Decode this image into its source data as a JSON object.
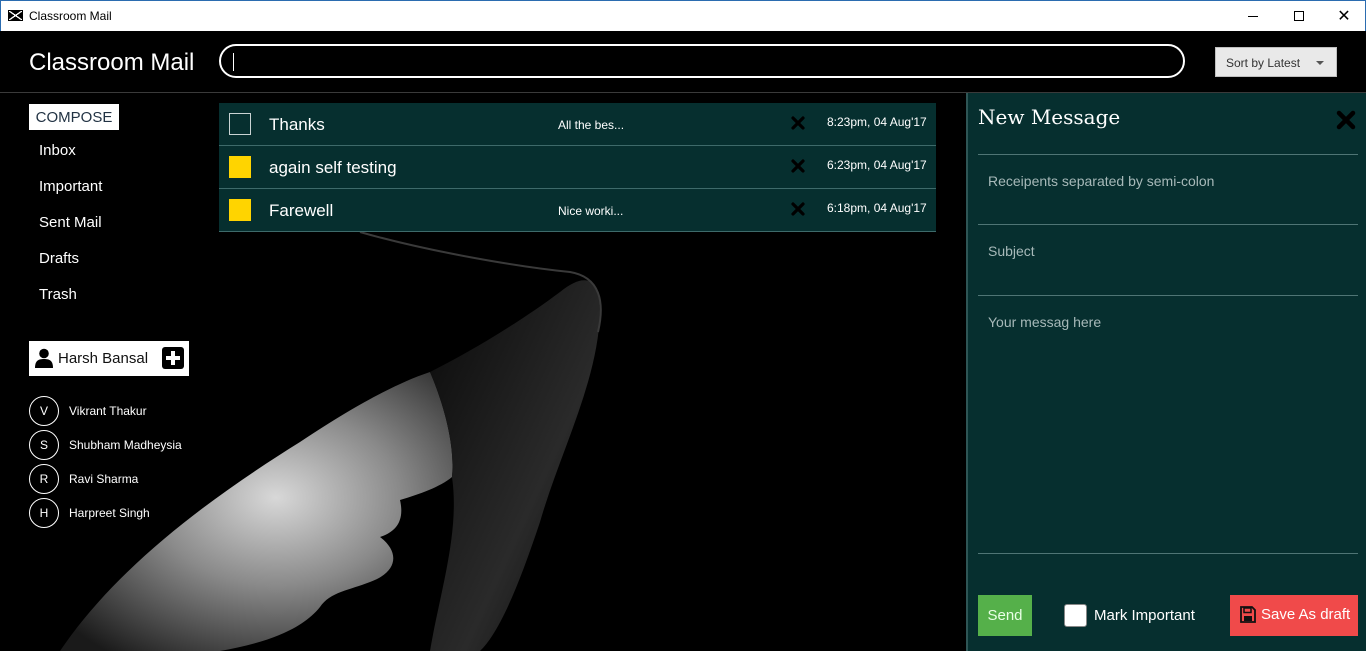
{
  "window": {
    "title": "Classroom Mail"
  },
  "header": {
    "app_title": "Classroom Mail",
    "search_value": "",
    "sort_label": "Sort by Latest"
  },
  "sidebar": {
    "compose_label": "COMPOSE",
    "items": [
      {
        "label": "Inbox"
      },
      {
        "label": "Important"
      },
      {
        "label": "Sent Mail"
      },
      {
        "label": "Drafts"
      },
      {
        "label": "Trash"
      }
    ],
    "user_name": "Harsh Bansal",
    "contacts": [
      {
        "initial": "V",
        "name": "Vikrant Thakur"
      },
      {
        "initial": "S",
        "name": "Shubham Madheysia"
      },
      {
        "initial": "R",
        "name": "Ravi Sharma"
      },
      {
        "initial": "H",
        "name": "Harpreet Singh"
      }
    ]
  },
  "mails": [
    {
      "subject": "Thanks",
      "snippet": "All the bes...",
      "date": "8:23pm, 04 Aug'17",
      "important": false
    },
    {
      "subject": "again self testing",
      "snippet": "",
      "date": "6:23pm, 04 Aug'17",
      "important": true
    },
    {
      "subject": "Farewell",
      "snippet": "Nice worki...",
      "date": "6:18pm, 04 Aug'17",
      "important": true
    }
  ],
  "compose": {
    "title": "New Message",
    "recipients_placeholder": "Receipents separated by semi-colon",
    "subject_placeholder": "Subject",
    "body_placeholder": "Your messag here",
    "send_label": "Send",
    "mark_important_label": "Mark Important",
    "save_draft_label": "Save As draft"
  },
  "colors": {
    "panel_bg": "#062f2f",
    "important_flag": "#ffd400",
    "send_button": "#55b04a",
    "draft_button": "#f04a4a"
  }
}
